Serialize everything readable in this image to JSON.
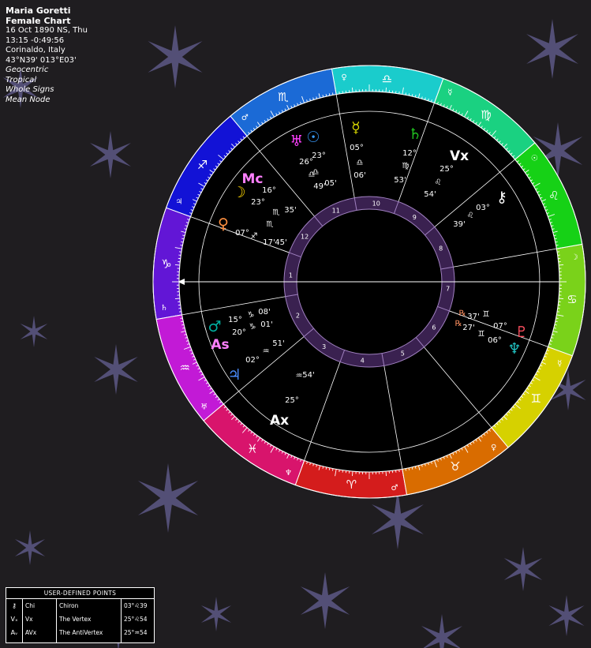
{
  "chart_info": {
    "name": "Maria Goretti",
    "chart_type": "Female Chart",
    "date": "16 Oct 1890 NS, Thu",
    "time": "13:15  -0:49:56",
    "place": "Corinaldo, Italy",
    "coords": "43°N39' 013°E03'",
    "options": [
      "Geocentric",
      "Tropical",
      "Whole Signs",
      "Mean Node"
    ]
  },
  "colors": {
    "background": "#1f1d20",
    "star": "#5d5886",
    "house_ring": "#3a2150"
  },
  "signs": [
    {
      "glyph": "♈",
      "icon": "aries-icon",
      "ruler": "♂",
      "ruler_icon": "mars-ruler-icon",
      "color": "#d41c1c"
    },
    {
      "glyph": "♉",
      "icon": "taurus-icon",
      "ruler": "♀",
      "ruler_icon": "venus-ruler-icon",
      "color": "#d96c00"
    },
    {
      "glyph": "♊",
      "icon": "gemini-icon",
      "ruler": "☿",
      "ruler_icon": "mercury-ruler-icon",
      "color": "#d6d100"
    },
    {
      "glyph": "♋",
      "icon": "cancer-icon",
      "ruler": "☽",
      "ruler_icon": "moon-ruler-icon",
      "color": "#7ad21a"
    },
    {
      "glyph": "♌",
      "icon": "leo-icon",
      "ruler": "☉",
      "ruler_icon": "sun-ruler-icon",
      "color": "#16d116"
    },
    {
      "glyph": "♍",
      "icon": "virgo-icon",
      "ruler": "☿",
      "ruler_icon": "mercury-ruler-icon",
      "color": "#1ad181"
    },
    {
      "glyph": "♎",
      "icon": "libra-icon",
      "ruler": "♀",
      "ruler_icon": "venus-ruler-icon",
      "color": "#1acccc"
    },
    {
      "glyph": "♏",
      "icon": "scorpio-icon",
      "ruler": "♂",
      "ruler_icon": "mars-ruler-icon",
      "color": "#1b6ad6"
    },
    {
      "glyph": "♐",
      "icon": "sagittarius-icon",
      "ruler": "♃",
      "ruler_icon": "jupiter-ruler-icon",
      "color": "#1212d6"
    },
    {
      "glyph": "♑",
      "icon": "capricorn-icon",
      "ruler": "♄",
      "ruler_icon": "saturn-ruler-icon",
      "color": "#6216d6"
    },
    {
      "glyph": "♒",
      "icon": "aquarius-icon",
      "ruler": "♅",
      "ruler_icon": "uranus-ruler-icon",
      "color": "#c21ad6"
    },
    {
      "glyph": "♓",
      "icon": "pisces-icon",
      "ruler": "♆",
      "ruler_icon": "neptune-ruler-icon",
      "color": "#d8146c"
    }
  ],
  "houses": [
    "1",
    "2",
    "3",
    "4",
    "5",
    "6",
    "7",
    "8",
    "9",
    "10",
    "11",
    "12"
  ],
  "planets": [
    {
      "name": "Sun",
      "glyph": "☉",
      "color": "#3a9dff",
      "lon": 203.4,
      "deg": "23°",
      "sign": "♎",
      "min": "05'",
      "retro": ""
    },
    {
      "name": "Moon",
      "glyph": "☽",
      "color": "#ffd700",
      "lon": 226.6,
      "deg": "16°",
      "sign": "♏",
      "min": "35'",
      "retro": ""
    },
    {
      "name": "Mercury",
      "glyph": "☿",
      "color": "#d8d800",
      "lon": 185.1,
      "deg": "05°",
      "sign": "♎",
      "min": "06'",
      "retro": ""
    },
    {
      "name": "Venus",
      "glyph": "♀",
      "color": "#ff9040",
      "lon": 247.3,
      "deg": "07°",
      "sign": "♐",
      "min": "17'",
      "retro": ""
    },
    {
      "name": "Mars",
      "glyph": "♂",
      "color": "#00b0a0",
      "lon": 285.1,
      "deg": "15°",
      "sign": "♑",
      "min": "08'",
      "retro": ""
    },
    {
      "name": "Jupiter",
      "glyph": "♃",
      "color": "#4a8cff",
      "lon": 302.9,
      "deg": "02°",
      "sign": "♒",
      "min": "51'",
      "retro": ""
    },
    {
      "name": "Saturn",
      "glyph": "♄",
      "color": "#20c020",
      "lon": 162.9,
      "deg": "12°",
      "sign": "♍",
      "min": "53'",
      "retro": ""
    },
    {
      "name": "Uranus",
      "glyph": "♅",
      "color": "#ff40ff",
      "lon": 206.8,
      "deg": "26°",
      "sign": "♎",
      "min": "49'",
      "retro": ""
    },
    {
      "name": "Neptune",
      "glyph": "♆",
      "color": "#20c0c0",
      "lon": 66.1,
      "deg": "06°",
      "sign": "♊",
      "min": "27'",
      "retro": "℞"
    },
    {
      "name": "Pluto",
      "glyph": "♇",
      "color": "#ff5060",
      "lon": 67.6,
      "deg": "07°",
      "sign": "♊",
      "min": "37'",
      "retro": "℞"
    },
    {
      "name": "Chiron",
      "glyph": "⚷",
      "color": "#ffffff",
      "lon": 123.6,
      "deg": "03°",
      "sign": "♌",
      "min": "39'",
      "retro": ""
    },
    {
      "name": "Vertex",
      "glyph": "Vx",
      "color": "#ffffff",
      "lon": 145.9,
      "deg": "25°",
      "sign": "♌",
      "min": "54'",
      "retro": ""
    },
    {
      "name": "Midheaven",
      "glyph": "Mc",
      "color": "#ff80ff",
      "lon": 233.4,
      "deg": "23°",
      "sign": "♏",
      "min": "45'",
      "retro": ""
    },
    {
      "name": "Ascendant",
      "glyph": "As",
      "color": "#ff80ff",
      "lon": 290.0,
      "deg": "20°",
      "sign": "♑",
      "min": "01'",
      "retro": ""
    },
    {
      "name": "AntiVertex",
      "glyph": "Ax",
      "color": "#ffffff",
      "lon": 325.9,
      "deg": "25°",
      "sign": "♒",
      "min": "54'",
      "retro": ""
    }
  ],
  "user_points": {
    "title": "USER-DEFINED POINTS",
    "rows": [
      {
        "sym": "⚷",
        "abbr": "Chi",
        "name": "Chiron",
        "pos": "03°♌39"
      },
      {
        "sym": "Vₓ",
        "abbr": "Vx",
        "name": "The Vertex",
        "pos": "25°♌54"
      },
      {
        "sym": "Aᵥ",
        "abbr": "AVx",
        "name": "The AntiVertex",
        "pos": "25°♒54"
      }
    ]
  }
}
